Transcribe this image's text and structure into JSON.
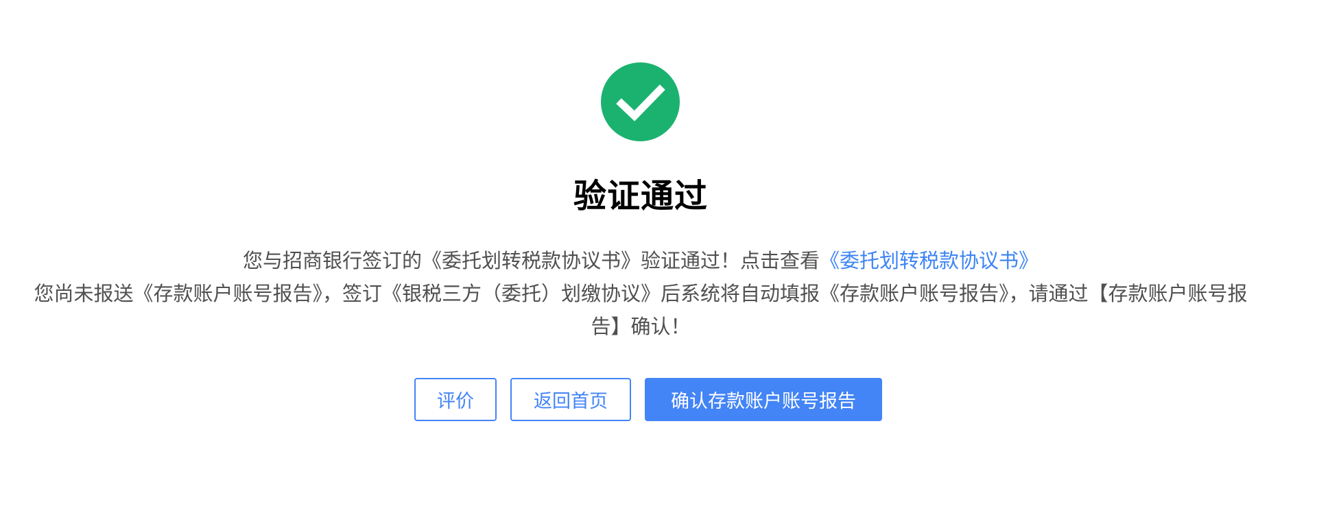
{
  "colors": {
    "success": "#1bb270",
    "primary": "#4384f6",
    "link": "#3d84f5"
  },
  "status_icon": "check-circle-icon",
  "title": "验证通过",
  "message": {
    "line1_prefix": "您与招商银行签订的《委托划转税款协议书》验证通过！点击查看",
    "line1_link": "《委托划转税款协议书》",
    "line2": "您尚未报送《存款账户账号报告》，签订《银税三方（委托）划缴协议》后系统将自动填报《存款账户账号报告》，请通过【存款账户账号报告】确认！"
  },
  "buttons": {
    "evaluate": "评价",
    "home": "返回首页",
    "confirm": "确认存款账户账号报告"
  }
}
